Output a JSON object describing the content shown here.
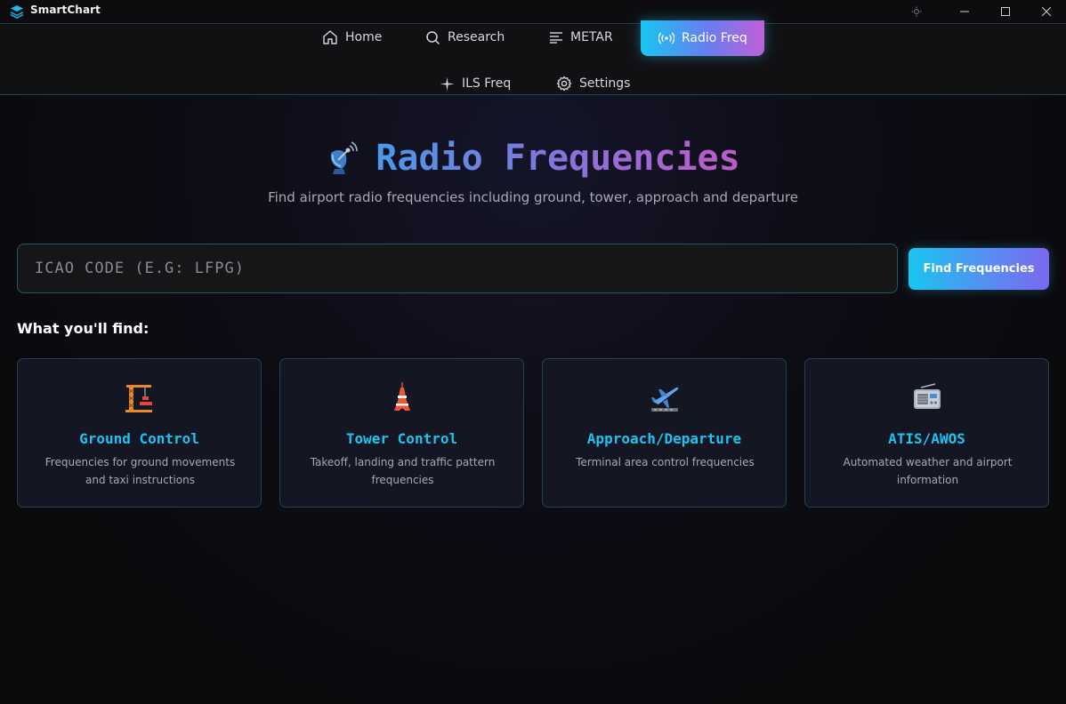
{
  "app": {
    "title": "SmartChart"
  },
  "nav": {
    "items": [
      {
        "label": "Home",
        "icon": "home-icon"
      },
      {
        "label": "Research",
        "icon": "search-icon"
      },
      {
        "label": "METAR",
        "icon": "list-icon"
      },
      {
        "label": "Radio Freq",
        "icon": "radio-wave-icon",
        "active": true
      },
      {
        "label": "ILS Freq",
        "icon": "sparkle-icon"
      },
      {
        "label": "Settings",
        "icon": "gear-icon"
      }
    ]
  },
  "hero": {
    "icon": "satellite-dish-icon",
    "title": "Radio Frequencies",
    "subtitle": "Find airport radio frequencies including ground, tower, approach and departure"
  },
  "search": {
    "placeholder": "ICAO CODE (E.G: LFPG)",
    "value": "",
    "button_label": "Find Frequencies"
  },
  "features": {
    "heading": "What you'll find:",
    "cards": [
      {
        "icon": "construction-crane-icon",
        "title": "Ground Control",
        "description": "Frequencies for ground movements and taxi instructions"
      },
      {
        "icon": "tower-icon",
        "title": "Tower Control",
        "description": "Takeoff, landing and traffic pattern frequencies"
      },
      {
        "icon": "airplane-departure-icon",
        "title": "Approach/Departure",
        "description": "Terminal area control frequencies"
      },
      {
        "icon": "radio-icon",
        "title": "ATIS/AWOS",
        "description": "Automated weather and airport information"
      }
    ]
  },
  "colors": {
    "accent_cyan": "#1cc4ef",
    "accent_purple": "#7a68ee",
    "accent_magenta": "#c05ac8",
    "background": "#0a0a0d",
    "card_bg": "#141623"
  }
}
